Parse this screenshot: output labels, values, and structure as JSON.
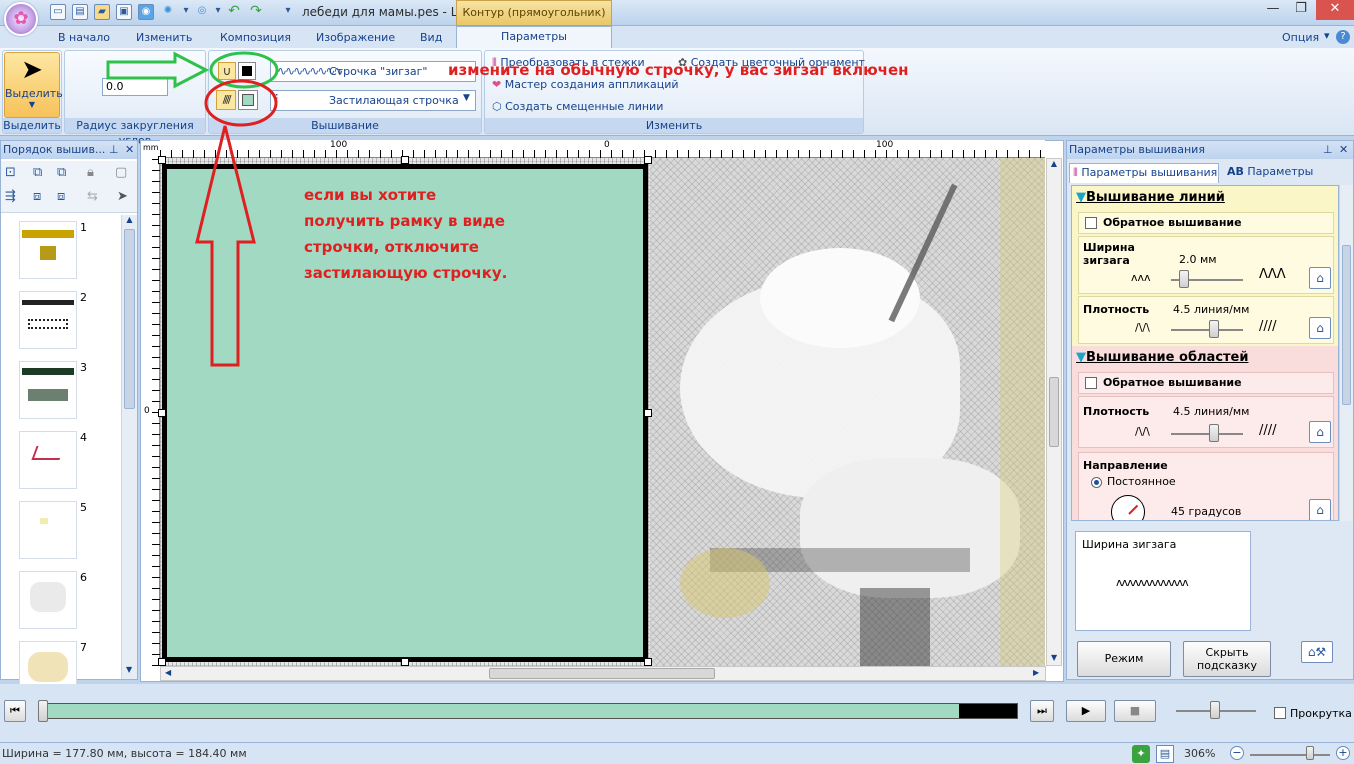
{
  "title_bar": {
    "document_title": "лебеди для мамы.pes - La...",
    "context_tab": "Контур (прямоугольник)"
  },
  "menu": {
    "tabs": [
      "В начало",
      "Изменить",
      "Композиция",
      "Изображение",
      "Вид",
      "Параметры"
    ],
    "right": "Опция"
  },
  "ribbon": {
    "select_label": "Выделить",
    "select_group_label": "Выделить",
    "radius_value": "0.0",
    "radius_group_label": "Радиус закругления углов",
    "line_stitch": "Строчка \"зигзаг\"",
    "fill_stitch": "Застилающая строчка",
    "sewing_group_label": "Вышивание",
    "convert_label": "Преобразовать в стежки",
    "ornament_label": "Создать цветочный орнамент",
    "applique_label": "Мастер создания аппликаций",
    "offset_label": "Создать смещенные линии",
    "modify_group_label": "Изменить"
  },
  "left_panel": {
    "title": "Порядок вышив...",
    "items": [
      "1",
      "2",
      "3",
      "4",
      "5",
      "6",
      "7"
    ]
  },
  "rulers": {
    "unit": "mm",
    "h_labels": [
      "100",
      "0",
      "100"
    ],
    "v_label": "0"
  },
  "annotations": {
    "top": "измените на обычную строчку, у вас зигзаг включен",
    "middle_lines": [
      "если вы хотите",
      "получить рамку в виде",
      "строчки, отключите",
      "застилающую строчку."
    ]
  },
  "right_panel": {
    "title": "Параметры вышивания",
    "tab_sewing": "Параметры вышивания",
    "tab_text_prefix": "AB",
    "tab_text": "Параметры текста",
    "line_section": "Вышивание линий",
    "reverse_label": "Обратное вышивание",
    "zigzag_width_label": "Ширина зигзага",
    "zigzag_width_value": "2.0 мм",
    "density_label": "Плотность",
    "density_value": "4.5 линия/мм",
    "area_section": "Вышивание областей",
    "reverse_label2": "Обратное вышивание",
    "area_density_label": "Плотность",
    "area_density_value": "4.5 линия/мм",
    "direction_label": "Направление",
    "direction_mode": "Постоянное",
    "direction_value": "45 градусов",
    "preview_label": "Ширина зигзага",
    "expert_button": "Режим \"Эксперт\"",
    "hide_hint_button": "Скрыть подсказку"
  },
  "playback": {
    "scroll_label": "Прокрутка",
    "progress": 0.94
  },
  "status": {
    "dimensions": "Ширина = 177.80 мм, высота = 184.40 мм",
    "zoom": "306%"
  }
}
